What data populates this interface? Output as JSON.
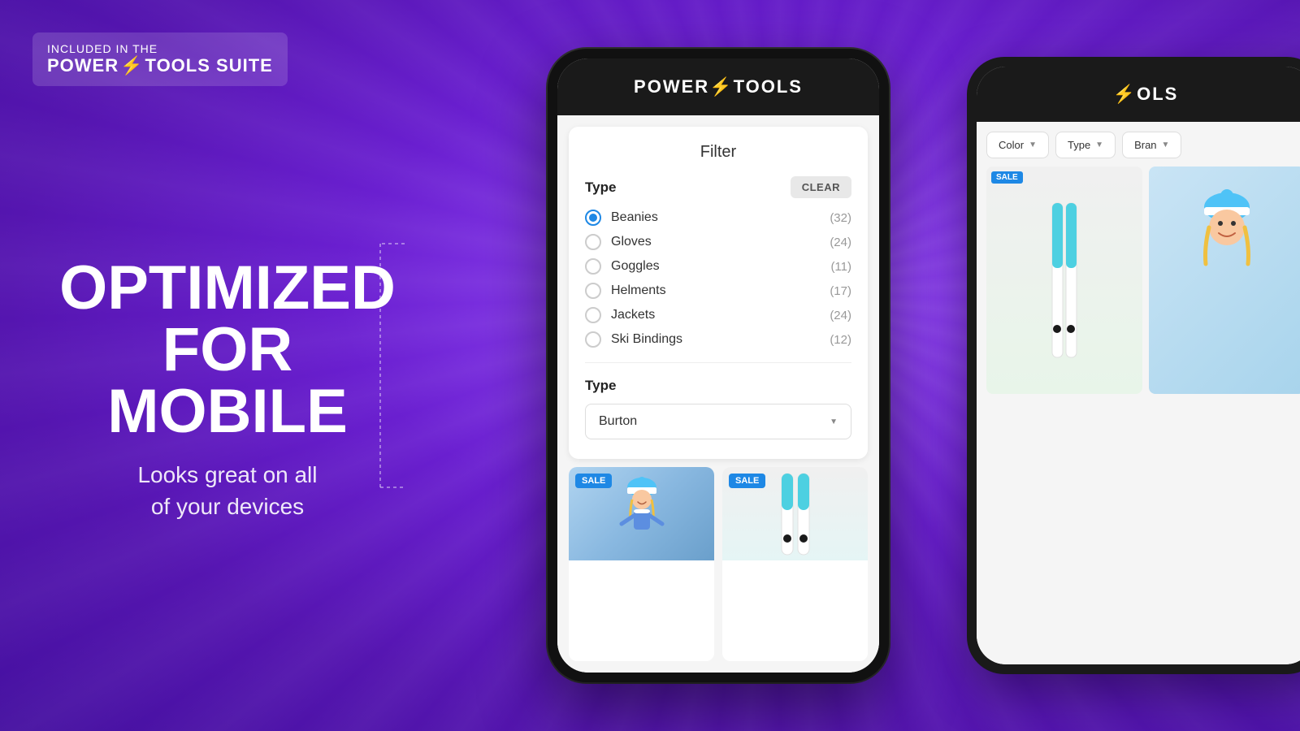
{
  "background": {
    "color": "#7b2ff7"
  },
  "badge": {
    "line1": "INCLUDED IN THE",
    "line2_part1": "POWER",
    "lightning": "⚡",
    "line2_part2": "TOOLS SUITE"
  },
  "hero": {
    "headline_line1": "OPTIMIZED",
    "headline_line2": "FOR",
    "headline_line3": "MOBILE",
    "subheadline": "Looks great on all\nof your devices"
  },
  "phone": {
    "header_title_part1": "POWER",
    "lightning": "⚡",
    "header_title_part2": "TOOLS",
    "filter": {
      "title": "Filter",
      "type_label": "Type",
      "clear_button": "CLEAR",
      "options": [
        {
          "label": "Beanies",
          "count": "(32)",
          "selected": true
        },
        {
          "label": "Gloves",
          "count": "(24)",
          "selected": false
        },
        {
          "label": "Goggles",
          "count": "(11)",
          "selected": false
        },
        {
          "label": "Helments",
          "count": "(17)",
          "selected": false
        },
        {
          "label": "Jackets",
          "count": "(24)",
          "selected": false
        },
        {
          "label": "Ski Bindings",
          "count": "(12)",
          "selected": false
        }
      ],
      "brand_label": "Type",
      "brand_value": "Burton",
      "brand_placeholder": "Burton"
    },
    "products": [
      {
        "sale": true,
        "type": "skier"
      },
      {
        "sale": true,
        "type": "ski_board"
      }
    ]
  },
  "bg_phone": {
    "header_title": "OLS",
    "filter_chips": [
      {
        "label": "Color",
        "has_chevron": true
      },
      {
        "label": "Type",
        "has_chevron": true
      },
      {
        "label": "Bran",
        "has_chevron": false
      }
    ],
    "products": [
      {
        "sale": true
      },
      {
        "sale": false
      }
    ]
  }
}
